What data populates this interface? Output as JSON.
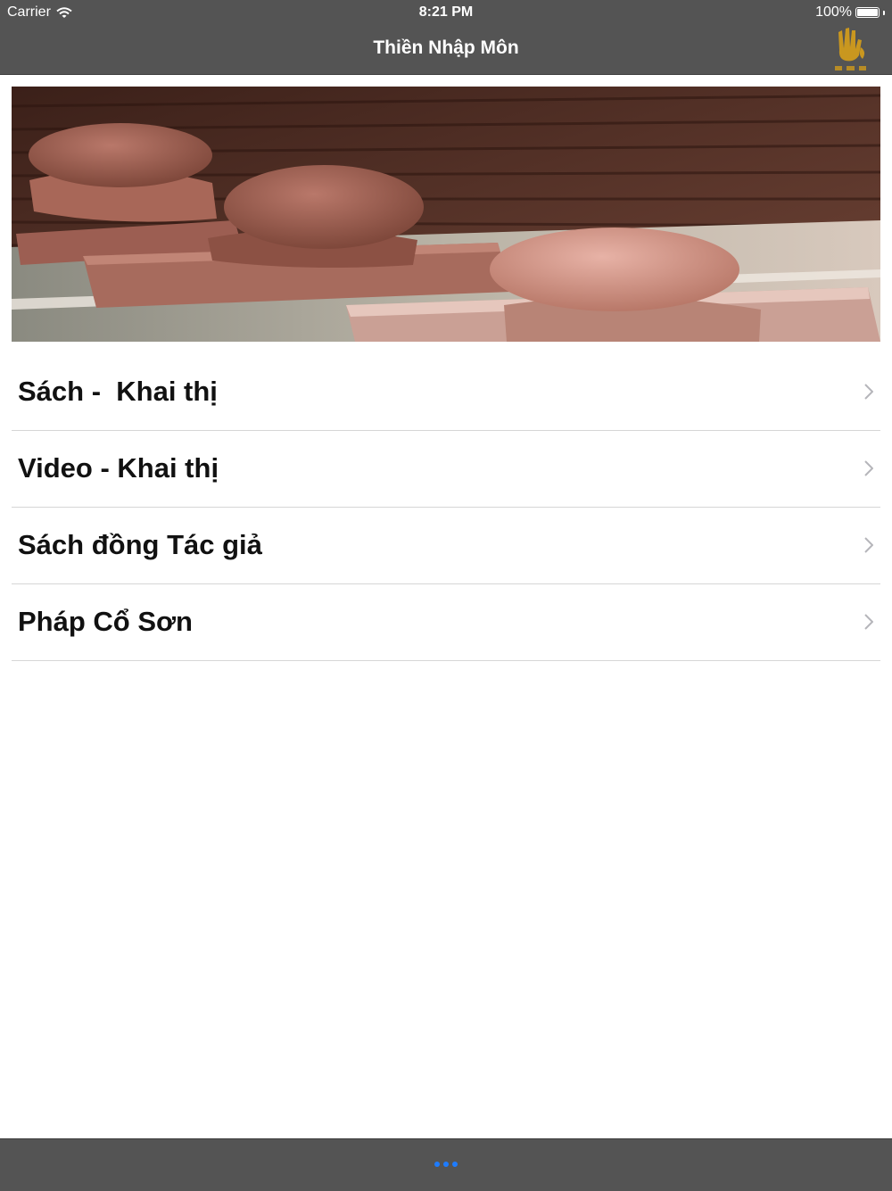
{
  "status_bar": {
    "carrier": "Carrier",
    "time": "8:21 PM",
    "battery": "100%"
  },
  "nav": {
    "title": "Thiền Nhập Môn",
    "logo_icon": "hand-logo-icon"
  },
  "menu": {
    "items": [
      {
        "label": "Sách -  Khai thị"
      },
      {
        "label": "Video - Khai thị"
      },
      {
        "label": "Sách đồng Tác giả"
      },
      {
        "label": "Pháp Cổ Sơn"
      }
    ]
  },
  "toolbar": {
    "more_icon": "more-dots-icon"
  },
  "colors": {
    "bar_background": "#545454",
    "accent": "#1e7cff",
    "logo_gold": "#c9971f"
  }
}
